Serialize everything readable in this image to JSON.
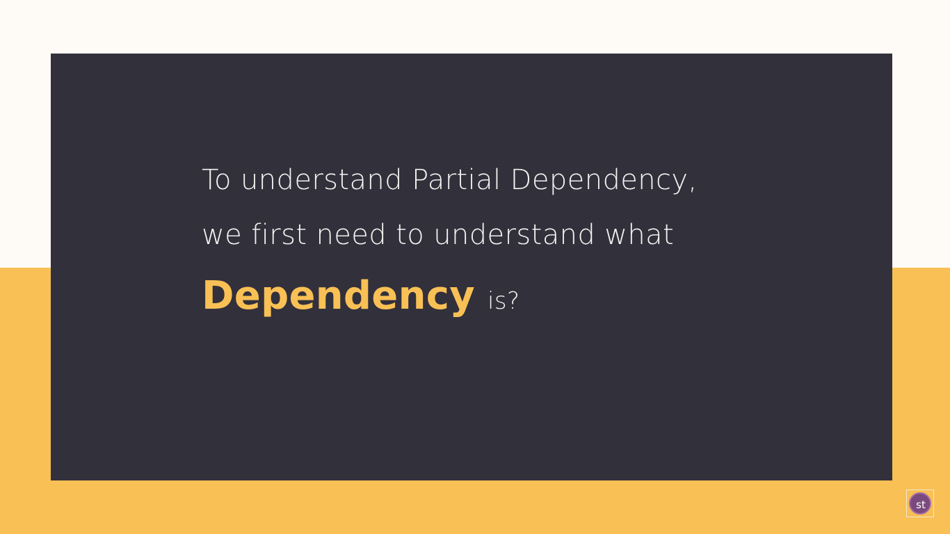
{
  "slide": {
    "line1": "To understand Partial Dependency,",
    "line2": "we first need to understand what",
    "highlight": "Dependency",
    "tail": "is?"
  },
  "logo": {
    "text": "st",
    "icon": "studytonight-logo-icon"
  },
  "colors": {
    "background_light": "#fefbf6",
    "background_accent": "#f8c055",
    "card": "#32303b",
    "text": "#f4f2f0",
    "highlight": "#f8c055",
    "logo_circle": "#7a4a7e"
  }
}
